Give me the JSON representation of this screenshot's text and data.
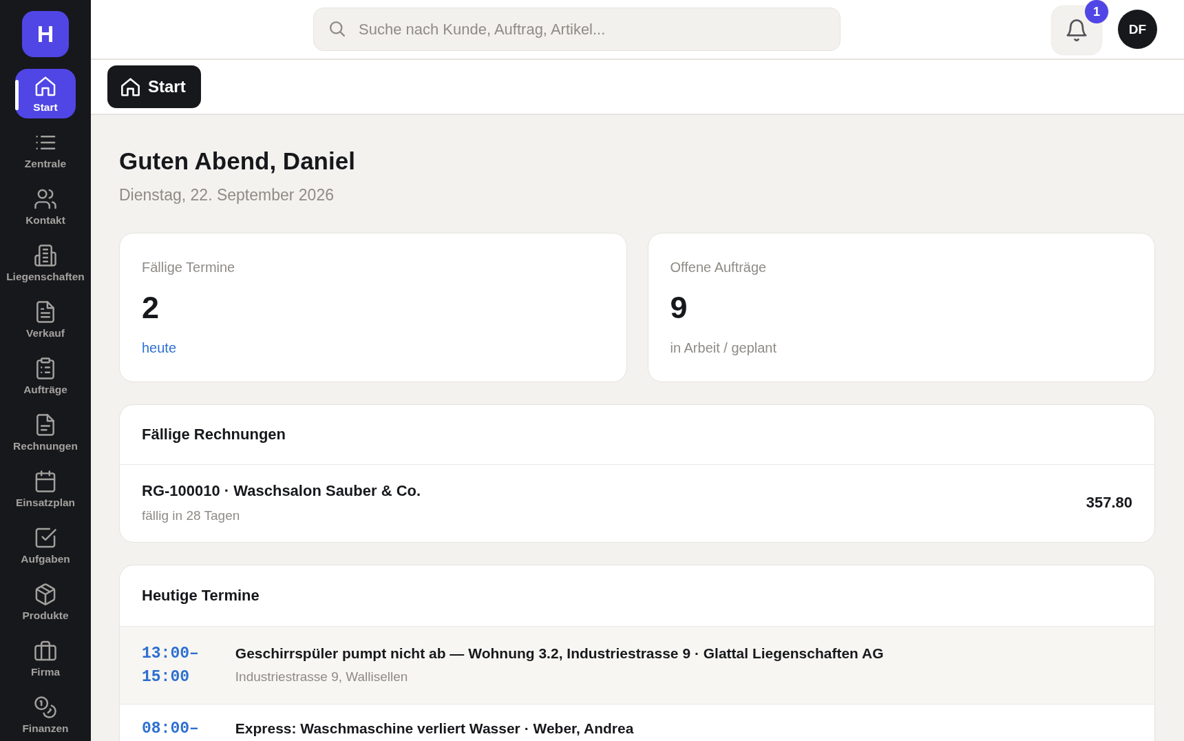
{
  "sidebar": {
    "logo": "H",
    "items": [
      {
        "label": "Start",
        "selected": true
      },
      {
        "label": "Zentrale",
        "selected": false
      },
      {
        "label": "Kontakt",
        "selected": false
      },
      {
        "label": "Liegenschaften",
        "selected": false
      },
      {
        "label": "Verkauf",
        "selected": false
      },
      {
        "label": "Aufträge",
        "selected": false
      },
      {
        "label": "Rechnungen",
        "selected": false
      },
      {
        "label": "Einsatzplan",
        "selected": false
      },
      {
        "label": "Aufgaben",
        "selected": false
      },
      {
        "label": "Produkte",
        "selected": false
      },
      {
        "label": "Firma",
        "selected": false
      },
      {
        "label": "Finanzen",
        "selected": false
      }
    ]
  },
  "topbar": {
    "search": {
      "placeholder": "Suche nach Kunde, Auftrag, Artikel..."
    },
    "notifications": {
      "count": "1"
    },
    "avatar": "DF"
  },
  "tabs": [
    {
      "label": "Start",
      "selected": true
    }
  ],
  "greeting": {
    "title": "Guten Abend, Daniel",
    "date": "Dienstag, 22. September 2026"
  },
  "stats": [
    {
      "label": "Fällige Termine",
      "value": "2",
      "note": "heute",
      "kind": "link"
    },
    {
      "label": "Offene Aufträge",
      "value": "9",
      "note": "in Arbeit / geplant",
      "kind": "text"
    }
  ],
  "invoices": {
    "title": "Fällige Rechnungen",
    "rows": [
      {
        "title": "RG-100010 · Waschsalon Sauber & Co.",
        "subtitle": "fällig in 28 Tagen",
        "amount": "357.80"
      }
    ]
  },
  "appointments": {
    "title": "Heutige Termine",
    "rows": [
      {
        "time": "13:00–15:00",
        "title": "Geschirrspüler pumpt nicht ab — Wohnung 3.2, Industriestrasse 9 · Glattal Liegenschaften AG",
        "subtitle": "Industriestrasse 9, Wallisellen",
        "selected": true
      },
      {
        "time": "08:00–",
        "title": "Express: Waschmaschine verliert Wasser · Weber, Andrea",
        "selected": false
      }
    ]
  }
}
